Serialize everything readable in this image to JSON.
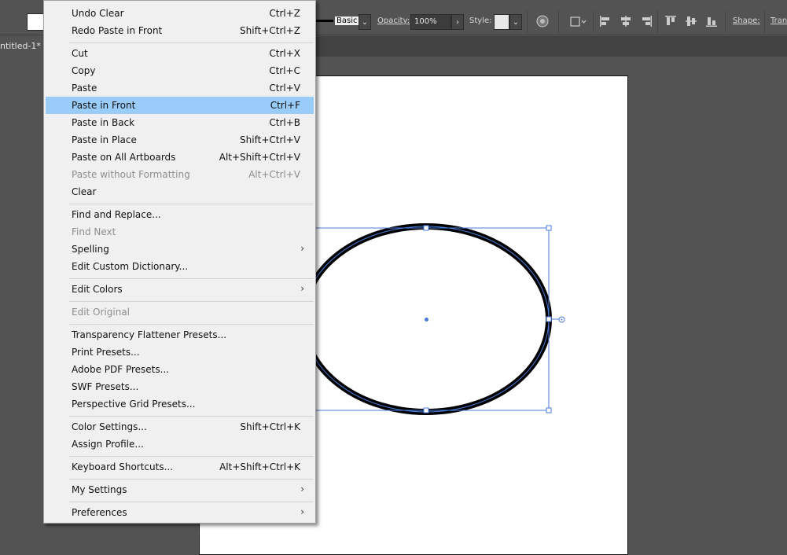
{
  "control_bar": {
    "basic_label": "Basic",
    "opacity_label": "Opacity:",
    "opacity_value": "100%",
    "style_label": "Style:",
    "shape_label": "Shape:",
    "transform_label": "Tran"
  },
  "document": {
    "tab_title": "ntitled-1*"
  },
  "menu": {
    "undo_clear": {
      "label": "Undo Clear",
      "shortcut": "Ctrl+Z"
    },
    "redo_paste_in_front": {
      "label": "Redo Paste in Front",
      "shortcut": "Shift+Ctrl+Z"
    },
    "cut": {
      "label": "Cut",
      "shortcut": "Ctrl+X"
    },
    "copy": {
      "label": "Copy",
      "shortcut": "Ctrl+C"
    },
    "paste": {
      "label": "Paste",
      "shortcut": "Ctrl+V"
    },
    "paste_in_front": {
      "label": "Paste in Front",
      "shortcut": "Ctrl+F"
    },
    "paste_in_back": {
      "label": "Paste in Back",
      "shortcut": "Ctrl+B"
    },
    "paste_in_place": {
      "label": "Paste in Place",
      "shortcut": "Shift+Ctrl+V"
    },
    "paste_on_all_artboards": {
      "label": "Paste on All Artboards",
      "shortcut": "Alt+Shift+Ctrl+V"
    },
    "paste_without_formatting": {
      "label": "Paste without Formatting",
      "shortcut": "Alt+Ctrl+V"
    },
    "clear": {
      "label": "Clear"
    },
    "find_and_replace": {
      "label": "Find and Replace..."
    },
    "find_next": {
      "label": "Find Next"
    },
    "spelling": {
      "label": "Spelling"
    },
    "edit_custom_dictionary": {
      "label": "Edit Custom Dictionary..."
    },
    "edit_colors": {
      "label": "Edit Colors"
    },
    "edit_original": {
      "label": "Edit Original"
    },
    "transparency_flattener_presets": {
      "label": "Transparency Flattener Presets..."
    },
    "print_presets": {
      "label": "Print Presets..."
    },
    "adobe_pdf_presets": {
      "label": "Adobe PDF Presets..."
    },
    "swf_presets": {
      "label": "SWF Presets..."
    },
    "perspective_grid_presets": {
      "label": "Perspective Grid Presets..."
    },
    "color_settings": {
      "label": "Color Settings...",
      "shortcut": "Shift+Ctrl+K"
    },
    "assign_profile": {
      "label": "Assign Profile..."
    },
    "keyboard_shortcuts": {
      "label": "Keyboard Shortcuts...",
      "shortcut": "Alt+Shift+Ctrl+K"
    },
    "my_settings": {
      "label": "My Settings"
    },
    "preferences": {
      "label": "Preferences"
    }
  },
  "colors": {
    "highlight": "#99ccf8",
    "selection": "#4a7bd8",
    "panel": "#535353"
  }
}
